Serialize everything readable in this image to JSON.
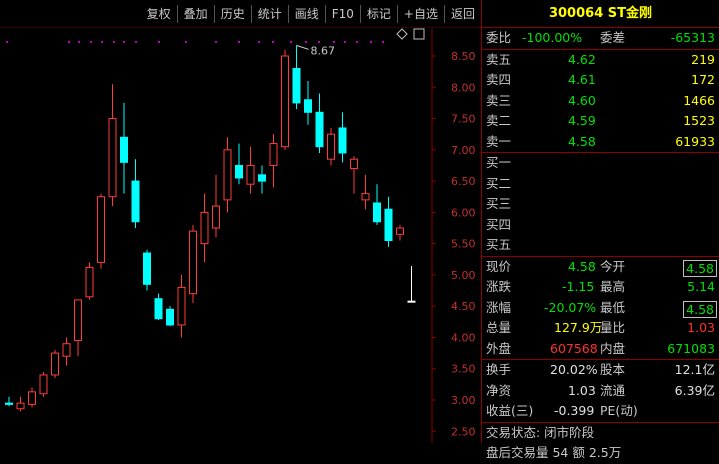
{
  "toolbar": {
    "buttons": [
      "复权",
      "叠加",
      "历史",
      "统计",
      "画线",
      "F10",
      "标记",
      "+自选",
      "返回"
    ]
  },
  "header": {
    "code": "300064",
    "name": "ST金刚"
  },
  "weibi": {
    "label": "委比",
    "value": "-100.00%",
    "label2": "委差",
    "value2": "-65313"
  },
  "asks": [
    {
      "label": "卖五",
      "price": "4.62",
      "vol": "219"
    },
    {
      "label": "卖四",
      "price": "4.61",
      "vol": "172"
    },
    {
      "label": "卖三",
      "price": "4.60",
      "vol": "1466"
    },
    {
      "label": "卖二",
      "price": "4.59",
      "vol": "1523"
    },
    {
      "label": "卖一",
      "price": "4.58",
      "vol": "61933"
    }
  ],
  "bids": [
    {
      "label": "买一"
    },
    {
      "label": "买二"
    },
    {
      "label": "买三"
    },
    {
      "label": "买四"
    },
    {
      "label": "买五"
    }
  ],
  "quote": {
    "now_l": "现价",
    "now_v": "4.58",
    "open_l": "今开",
    "open_v": "4.58",
    "chg_l": "涨跌",
    "chg_v": "-1.15",
    "high_l": "最高",
    "high_v": "5.14",
    "pct_l": "涨幅",
    "pct_v": "-20.07%",
    "low_l": "最低",
    "low_v": "4.58",
    "vol_l": "总量",
    "vol_v": "127.9万",
    "vr_l": "量比",
    "vr_v": "1.03",
    "out_l": "外盘",
    "out_v": "607568",
    "in_l": "内盘",
    "in_v": "671083"
  },
  "fund": {
    "turn_l": "换手",
    "turn_v": "20.02%",
    "cap_l": "股本",
    "cap_v": "12.1亿",
    "nav_l": "净资",
    "nav_v": "1.03",
    "float_l": "流通",
    "float_v": "6.39亿",
    "eps_l": "收益(三)",
    "eps_v": "-0.399",
    "pe_l": "PE(动)",
    "pe_v": ""
  },
  "status": {
    "state": "交易状态: 闭市阶段",
    "after": "盘后交易量 54 额 2.5万"
  },
  "chart_data": {
    "type": "candlestick",
    "y_ticks": [
      "8.50",
      "8.00",
      "7.50",
      "7.00",
      "6.50",
      "6.00",
      "5.50",
      "5.00",
      "4.50",
      "4.00",
      "3.50",
      "3.00",
      "2.50"
    ],
    "ylim": [
      2.35,
      8.75
    ],
    "high_label": "8.67",
    "colors": {
      "up": "#ff3c3c",
      "down": "#00ffff",
      "grid": "#8b0000",
      "dots": "#c000c0"
    },
    "candles": [
      {
        "o": 2.95,
        "c": 2.93,
        "h": 3.05,
        "l": 2.9
      },
      {
        "o": 2.86,
        "c": 2.95,
        "h": 3.05,
        "l": 2.82
      },
      {
        "o": 2.93,
        "c": 3.13,
        "h": 3.2,
        "l": 2.88
      },
      {
        "o": 3.1,
        "c": 3.4,
        "h": 3.45,
        "l": 3.05
      },
      {
        "o": 3.4,
        "c": 3.75,
        "h": 3.8,
        "l": 3.35
      },
      {
        "o": 3.7,
        "c": 3.9,
        "h": 4.0,
        "l": 3.55
      },
      {
        "o": 3.95,
        "c": 4.6,
        "h": 4.6,
        "l": 3.7
      },
      {
        "o": 4.65,
        "c": 5.12,
        "h": 5.2,
        "l": 4.6
      },
      {
        "o": 5.2,
        "c": 6.25,
        "h": 6.3,
        "l": 5.1
      },
      {
        "o": 6.25,
        "c": 7.5,
        "h": 8.05,
        "l": 6.1
      },
      {
        "o": 7.2,
        "c": 6.8,
        "h": 7.75,
        "l": 6.3
      },
      {
        "o": 6.5,
        "c": 5.85,
        "h": 6.85,
        "l": 5.75
      },
      {
        "o": 5.35,
        "c": 4.85,
        "h": 5.4,
        "l": 4.75
      },
      {
        "o": 4.62,
        "c": 4.3,
        "h": 4.7,
        "l": 4.28
      },
      {
        "o": 4.45,
        "c": 4.2,
        "h": 4.5,
        "l": 4.18
      },
      {
        "o": 4.2,
        "c": 4.8,
        "h": 5.0,
        "l": 4.0
      },
      {
        "o": 4.7,
        "c": 5.7,
        "h": 5.8,
        "l": 4.55
      },
      {
        "o": 5.5,
        "c": 6.0,
        "h": 6.3,
        "l": 5.2
      },
      {
        "o": 5.75,
        "c": 6.1,
        "h": 6.6,
        "l": 5.6
      },
      {
        "o": 6.2,
        "c": 7.0,
        "h": 7.2,
        "l": 6.0
      },
      {
        "o": 6.75,
        "c": 6.55,
        "h": 7.1,
        "l": 6.45
      },
      {
        "o": 6.45,
        "c": 6.75,
        "h": 7.05,
        "l": 6.3
      },
      {
        "o": 6.6,
        "c": 6.5,
        "h": 6.75,
        "l": 6.3
      },
      {
        "o": 6.75,
        "c": 7.1,
        "h": 7.25,
        "l": 6.4
      },
      {
        "o": 7.05,
        "c": 8.5,
        "h": 8.6,
        "l": 7.0
      },
      {
        "o": 8.3,
        "c": 7.75,
        "h": 8.67,
        "l": 7.65
      },
      {
        "o": 7.8,
        "c": 7.6,
        "h": 8.1,
        "l": 7.4
      },
      {
        "o": 7.6,
        "c": 7.05,
        "h": 7.9,
        "l": 6.95
      },
      {
        "o": 6.85,
        "c": 7.25,
        "h": 7.35,
        "l": 6.75
      },
      {
        "o": 7.35,
        "c": 6.95,
        "h": 7.6,
        "l": 6.8
      },
      {
        "o": 6.7,
        "c": 6.85,
        "h": 6.9,
        "l": 6.3
      },
      {
        "o": 6.2,
        "c": 6.3,
        "h": 6.6,
        "l": 6.05
      },
      {
        "o": 6.15,
        "c": 5.85,
        "h": 6.45,
        "l": 5.8
      },
      {
        "o": 6.05,
        "c": 5.55,
        "h": 6.25,
        "l": 5.45
      },
      {
        "o": 5.65,
        "c": 5.75,
        "h": 5.8,
        "l": 5.55
      },
      {
        "o": 4.58,
        "c": 4.58,
        "h": 5.14,
        "l": 4.58
      }
    ]
  }
}
